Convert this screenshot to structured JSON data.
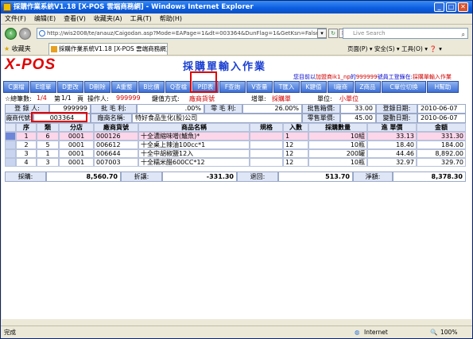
{
  "window": {
    "title": "採購作業系統V1.18 [X-POS 雲端商務網] - Windows Internet Explorer"
  },
  "menu": [
    "文件(F)",
    "编辑(E)",
    "查看(V)",
    "收藏夹(A)",
    "工具(T)",
    "帮助(H)"
  ],
  "address": {
    "url": "http://wis2008/te/anauz/Caigodan.asp?Mode=EAPage=1&dt=003364&DunFlag=1&GetKsn=False&auto",
    "search_placeholder": "Live Search"
  },
  "favbar": {
    "favorites": "收藏夹",
    "tab_title": "採購作業系統V1.18 [X-POS 雲端商務網]",
    "tools": "页面(P) ▾  安全(S) ▾  工具(O) ▾  ❓ ▾"
  },
  "app": {
    "logo": "X-POS",
    "title": "採購單輸入作業",
    "notice": {
      "prefix": "您目前以",
      "store": "加盟商ik1_np",
      "mid": "的",
      "staff": "999999",
      "mid2": "號員工登錄在:",
      "suffix": "採購單輸入作業"
    }
  },
  "toolbar": [
    "C選檔",
    "E增單",
    "D更改",
    "D刪除",
    "A重整",
    "B比價",
    "Q查檔",
    "P印表",
    "F查詢",
    "V查量",
    "T匯入",
    "K鍵值",
    "I廠商",
    "Z商品",
    "C單位切換",
    "H幫助"
  ],
  "info": {
    "label_count": "☆總筆數:",
    "count": "1/4",
    "page_label": "第",
    "page": "1/1",
    "page_suffix": "頁",
    "operator_label": "操作人:",
    "operator": "999999",
    "keymode_label": "鍵值方式:",
    "keymode": "廠商貨號",
    "add_label": "增單:",
    "add_val": "採購單",
    "unit_label": "單位:",
    "unit_val": "小單位"
  },
  "header": {
    "entry_label": "登 錄 人:",
    "entry_val": "999999",
    "gross_label": "批 毛 利:",
    "gross_val": ".00%",
    "retail_gross_label": "零 毛 利:",
    "retail_gross_val": "26.00%",
    "box_label": "批售箱價:",
    "box_val": "33.00",
    "reg_date_label": "登錄日期:",
    "reg_date_val": "2010-06-07",
    "vendor_label": "廠商代號:",
    "vendor_val": "003364",
    "vname_label": "廠商名稱:",
    "vname_val": "特好食品生化(股)公司",
    "retail_label": "零售單價:",
    "retail_val": "45.00",
    "chg_date_label": "變動日期:",
    "chg_date_val": "2010-06-07"
  },
  "grid": {
    "headers": [
      "序",
      "類",
      "分店",
      "廠商貨號",
      "商品名稱",
      "規格",
      "入數",
      "採購數量",
      "進 單價",
      "金額"
    ],
    "rows": [
      {
        "seq": "1",
        "type": "6",
        "branch": "0001",
        "code": "000126",
        "name": "十全濃縮味噌(鱸魚)*",
        "spec": "",
        "pack": "1",
        "qty": "10組",
        "price": "33.13",
        "amount": "331.30"
      },
      {
        "seq": "2",
        "type": "5",
        "branch": "0001",
        "code": "006612",
        "name": "十全桌上辣油100cc*1",
        "spec": "",
        "pack": "12",
        "qty": "10瓶",
        "price": "18.40",
        "amount": "184.00"
      },
      {
        "seq": "3",
        "type": "1",
        "branch": "0001",
        "code": "006644",
        "name": "十全中胡椒鹽12入",
        "spec": "",
        "pack": "12",
        "qty": "200罐",
        "price": "44.46",
        "amount": "8,892.00"
      },
      {
        "seq": "4",
        "type": "3",
        "branch": "0001",
        "code": "007003",
        "name": "十全糯米醋600CC*12",
        "spec": "",
        "pack": "12",
        "qty": "10瓶",
        "price": "32.97",
        "amount": "329.70"
      }
    ]
  },
  "totals": {
    "purchase_label": "採購:",
    "purchase_val": "8,560.70",
    "discount_label": "折讓:",
    "discount_val": "-331.30",
    "return_label": "退回:",
    "return_val": "513.70",
    "net_label": "淨額:",
    "net_val": "8,378.30"
  },
  "status": {
    "left": "完成",
    "zone": "Internet",
    "zoom": "100%"
  }
}
